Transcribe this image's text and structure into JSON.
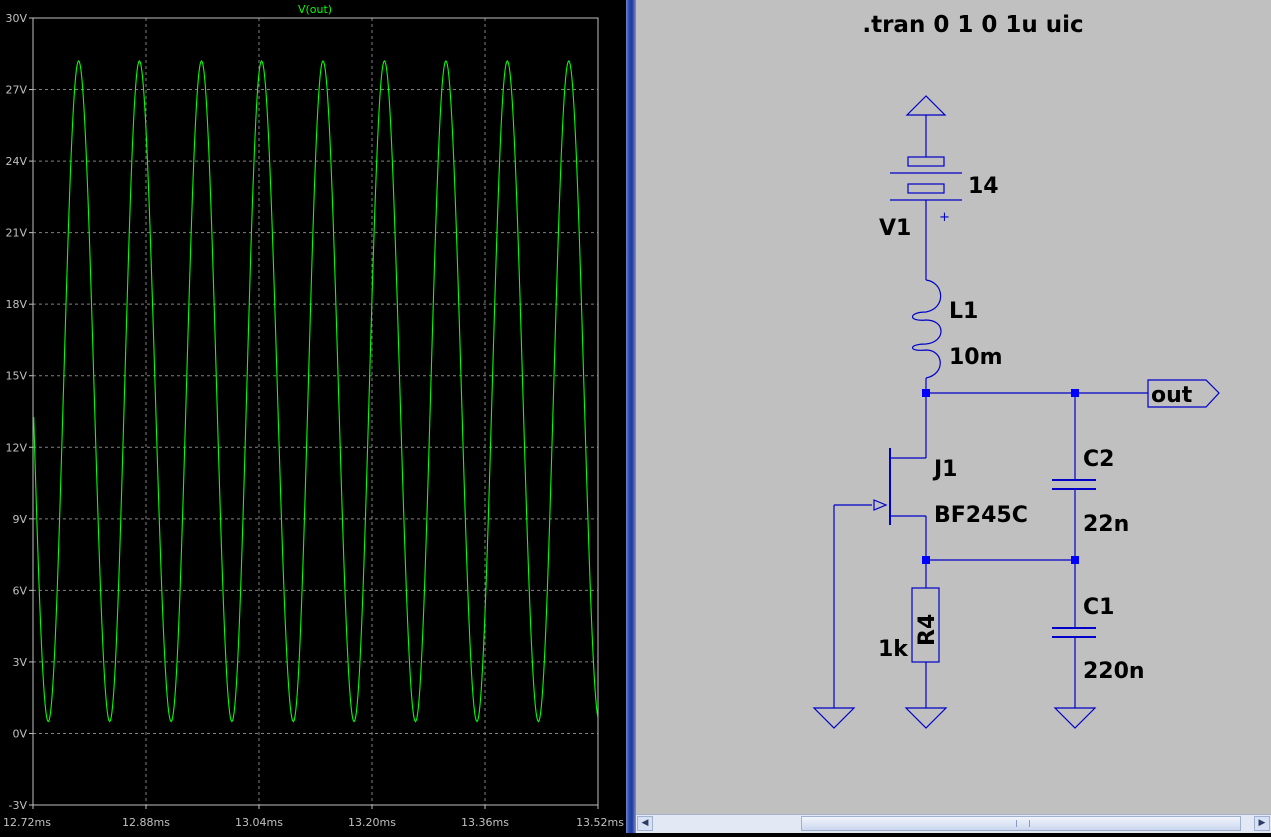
{
  "plot": {
    "trace_label": "V(out)",
    "y_unit": "V",
    "x_ticks": [
      "12.72ms",
      "12.88ms",
      "13.04ms",
      "13.20ms",
      "13.36ms",
      "13.52ms"
    ],
    "y_ticks": [
      "30V",
      "27V",
      "24V",
      "21V",
      "18V",
      "15V",
      "12V",
      "9V",
      "6V",
      "3V",
      "0V",
      "-3V"
    ],
    "colors": {
      "background": "#000000",
      "trace": "#00ff00",
      "grid": "#808080",
      "axis_text": "#c0c0c0"
    }
  },
  "chart_data": {
    "type": "line",
    "title": "V(out)",
    "xlabel": "",
    "ylabel": "",
    "xlim": [
      12.72,
      13.52
    ],
    "ylim": [
      -3,
      30
    ],
    "x_unit": "ms",
    "y_unit": "V",
    "grid": true,
    "series": [
      {
        "name": "V(out)",
        "peak_x": [
          12.7846,
          12.8706,
          12.9586,
          13.0436,
          13.1306,
          13.2176,
          13.3046,
          13.3916,
          13.4786
        ],
        "peak_y": 28.2,
        "trough_x": [
          12.7416,
          12.8286,
          12.9156,
          13.0016,
          13.0886,
          13.1746,
          13.2616,
          13.3486,
          13.4356
        ],
        "trough_y": 0.5
      }
    ]
  },
  "schematic": {
    "directive": ".tran 0 1 0 1u uic",
    "v1": {
      "ref": "V1",
      "value": "14",
      "plus": "+"
    },
    "l1": {
      "ref": "L1",
      "value": "10m"
    },
    "j1": {
      "ref": "J1",
      "model": "BF245C"
    },
    "c2": {
      "ref": "C2",
      "value": "22n"
    },
    "c1": {
      "ref": "C1",
      "value": "220n"
    },
    "r4": {
      "ref": "R4",
      "value": "1k"
    },
    "net_label": "out",
    "colors": {
      "background": "#c0c0c0",
      "wire": "#0000c8",
      "junction": "#0000ff",
      "text": "#000000"
    }
  },
  "scrollbar": {
    "left_arrow": "◀",
    "right_arrow": "▶"
  }
}
